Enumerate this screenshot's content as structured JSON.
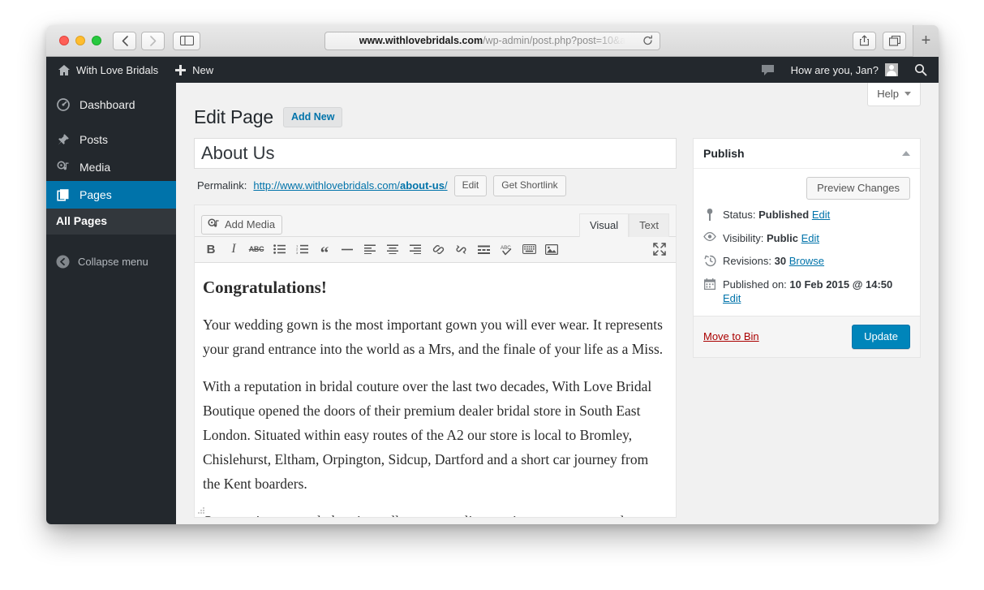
{
  "browser": {
    "url_prefix": "www.withlovebridals.com",
    "url_path": "/wp-admin/post.php?post=10&a",
    "back_label": "‹",
    "forward_label": "›"
  },
  "adminbar": {
    "site_name": "With Love Bridals",
    "new_label": "New",
    "howdy": "How are you, Jan?"
  },
  "sidebar": {
    "items": [
      {
        "label": "Dashboard",
        "icon": "dashboard-icon",
        "active": false
      },
      {
        "label": "Posts",
        "icon": "pin-icon",
        "active": false
      },
      {
        "label": "Media",
        "icon": "media-icon",
        "active": false
      },
      {
        "label": "Pages",
        "icon": "pages-icon",
        "active": true
      }
    ],
    "submenu": [
      {
        "label": "All Pages"
      }
    ],
    "collapse_label": "Collapse menu"
  },
  "content": {
    "help_label": "Help",
    "page_title": "Edit Page",
    "add_new_label": "Add New",
    "post_title": "About Us",
    "permalink_label": "Permalink:",
    "permalink_base": "http://www.withlovebridals.com/",
    "permalink_slug": "about-us",
    "permalink_tail": "/",
    "edit_slug_label": "Edit",
    "shortlink_label": "Get Shortlink"
  },
  "editor": {
    "add_media_label": "Add Media",
    "tab_visual": "Visual",
    "tab_text": "Text",
    "toolbar": [
      {
        "name": "bold-icon",
        "glyph": "B"
      },
      {
        "name": "italic-icon",
        "glyph": "I"
      },
      {
        "name": "strikethrough-icon",
        "glyph": "ABC"
      },
      {
        "name": "bulleted-list-icon",
        "glyph": ""
      },
      {
        "name": "numbered-list-icon",
        "glyph": ""
      },
      {
        "name": "blockquote-icon",
        "glyph": "“"
      },
      {
        "name": "horizontal-rule-icon",
        "glyph": "—"
      },
      {
        "name": "align-left-icon",
        "glyph": ""
      },
      {
        "name": "align-center-icon",
        "glyph": ""
      },
      {
        "name": "align-right-icon",
        "glyph": ""
      },
      {
        "name": "insert-link-icon",
        "glyph": ""
      },
      {
        "name": "unlink-icon",
        "glyph": ""
      },
      {
        "name": "read-more-tag-icon",
        "glyph": ""
      },
      {
        "name": "spellcheck-icon",
        "glyph": "ABC"
      },
      {
        "name": "keyboard-shortcuts-icon",
        "glyph": ""
      },
      {
        "name": "insert-image-icon",
        "glyph": ""
      },
      {
        "name": "fullscreen-icon",
        "glyph": ""
      }
    ],
    "document": {
      "heading": "Congratulations!",
      "paragraphs": [
        "Your wedding gown is the most important gown you will ever wear. It represents your grand entrance into the world as a Mrs, and the finale of your life as a Miss.",
        "With a reputation in bridal couture over the last two decades, With Love Bridal Boutique opened the doors of their premium dealer bridal store in South East London. Situated within easy routes of the A2 our store is local to Bromley, Chislehurst, Eltham, Orpington, Sidcup, Dartford and a short car journey from the Kent boarders.",
        "Our appointment only boutique allows our stylists to give a more personal service and memorable bridal experience."
      ]
    }
  },
  "publish": {
    "title": "Publish",
    "preview_label": "Preview Changes",
    "status_label": "Status:",
    "status_value": "Published",
    "status_edit": "Edit",
    "visibility_label": "Visibility:",
    "visibility_value": "Public",
    "visibility_edit": "Edit",
    "revisions_label": "Revisions:",
    "revisions_value": "30",
    "revisions_browse": "Browse",
    "published_on_label": "Published on:",
    "published_on_value": "10 Feb 2015 @ 14:50",
    "published_edit": "Edit",
    "trash_label": "Move to Bin",
    "update_label": "Update"
  },
  "colors": {
    "wp_blue": "#0073aa",
    "wp_dark": "#23282d",
    "update_button": "#0085ba",
    "trash_red": "#a00000",
    "link": "#0073aa"
  }
}
